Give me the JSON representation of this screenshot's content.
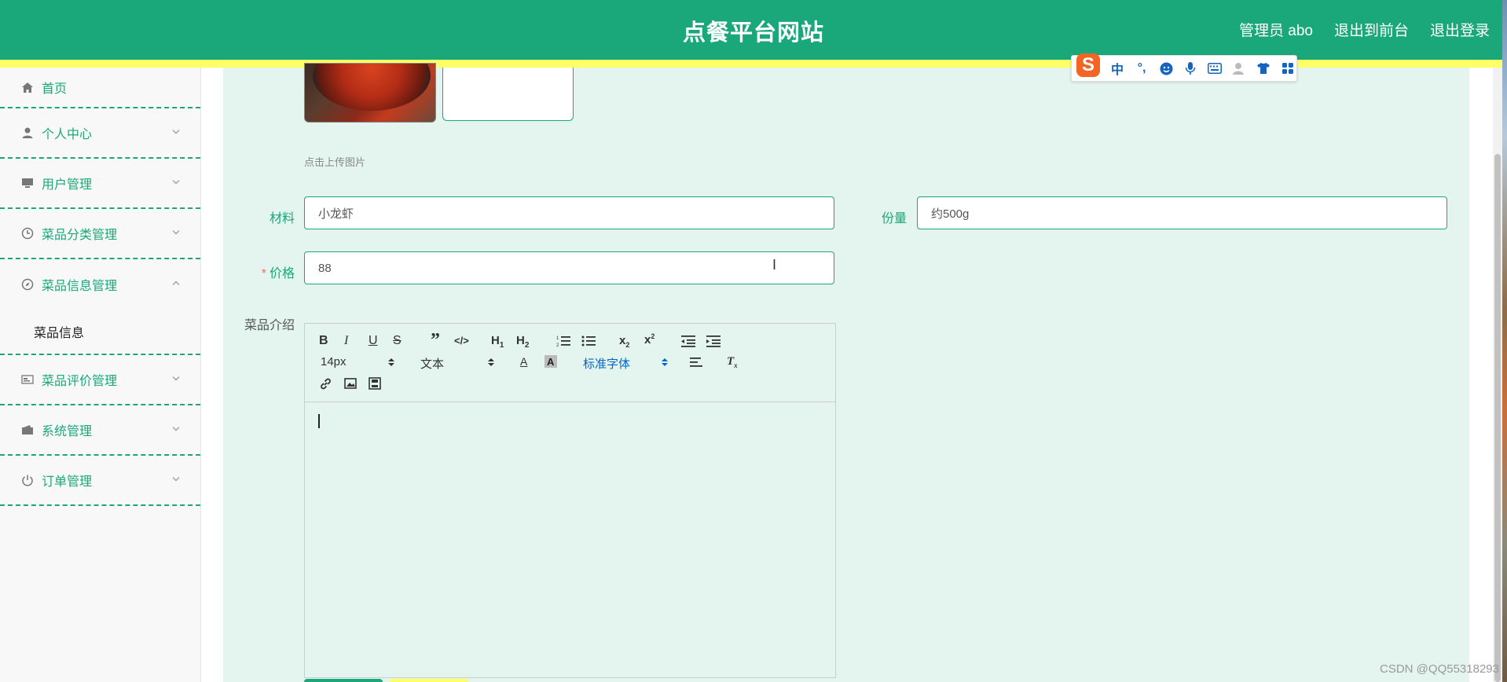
{
  "header": {
    "title": "点餐平台网站",
    "admin_label": "管理员 abo",
    "front_link": "退出到前台",
    "logout_link": "退出登录"
  },
  "sidebar": {
    "items": [
      {
        "label": "首页",
        "icon": "home-icon"
      },
      {
        "label": "个人中心",
        "icon": "user-icon"
      },
      {
        "label": "用户管理",
        "icon": "monitor-icon"
      },
      {
        "label": "菜品分类管理",
        "icon": "clock-icon"
      },
      {
        "label": "菜品信息管理",
        "icon": "compass-icon"
      },
      {
        "label": "菜品评价管理",
        "icon": "card-icon"
      },
      {
        "label": "系统管理",
        "icon": "wallet-icon"
      },
      {
        "label": "订单管理",
        "icon": "power-icon"
      }
    ],
    "sub_item": "菜品信息"
  },
  "form": {
    "upload_tip": "点击上传图片",
    "material_label": "材料",
    "material_value": "小龙虾",
    "portion_label": "份量",
    "portion_value": "约500g",
    "price_label": "价格",
    "price_required": "*",
    "price_value": "88",
    "intro_label": "菜品介绍"
  },
  "editor": {
    "font_size": "14px",
    "block_type": "文本",
    "font_family": "标准字体",
    "h1": "H",
    "h2": "H"
  },
  "ime": {
    "logo": "S",
    "mode": "中",
    "punct": "°,"
  },
  "watermark": "CSDN @QQ55318293",
  "colors": {
    "primary": "#1aa77a",
    "accent_strip": "#ffff66",
    "main_bg": "#e4f4ee"
  }
}
